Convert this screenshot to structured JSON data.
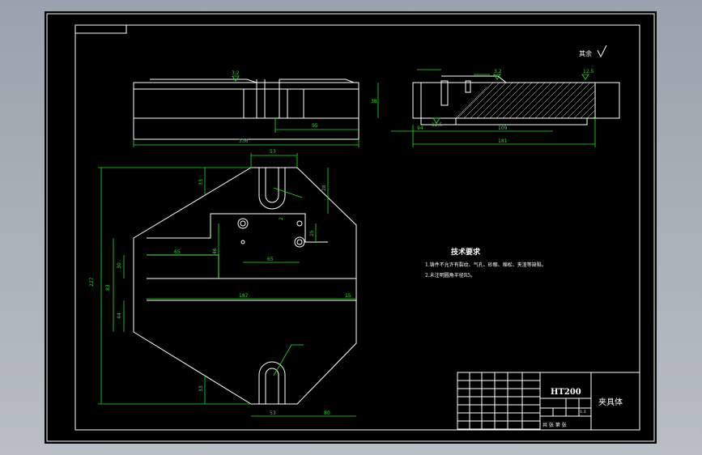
{
  "dimensions": {
    "top_view_total": "336",
    "top_view_right": "95",
    "side_height": "38",
    "side_left": "94",
    "side_mid": "109",
    "side_total": "181",
    "front_slot_top": "53",
    "front_slot_bottom": "53",
    "front_top_depth": "33",
    "front_right_top": "28",
    "front_height": "227",
    "front_left_mid": "83",
    "front_left_lower": "44",
    "front_left_upper": "30",
    "front_inner_height": "46",
    "front_hole_spacing_x": "65",
    "front_hole_spacing_y": "25",
    "front_step_width": "65",
    "front_long_width": "187",
    "front_right_small": "15",
    "front_bottom_right": "80",
    "front_bottom_depth": "33",
    "front_small_offset": "2"
  },
  "roughness": {
    "top_view": "3.2",
    "side_left": "3.2",
    "side_right": "12.5",
    "side_bottom": "12.5",
    "general": "其余"
  },
  "notes": {
    "title": "技术要求",
    "line1": "1.铸件不允许有裂纹、气孔、砂眼、缩松、夹渣等缺陷。",
    "line2": "2.未注明圆角半径R5。"
  },
  "title_block": {
    "material": "HT200",
    "part_name": "夹具体",
    "scale": "1:1",
    "sheet_label": "共 张 第 张"
  }
}
